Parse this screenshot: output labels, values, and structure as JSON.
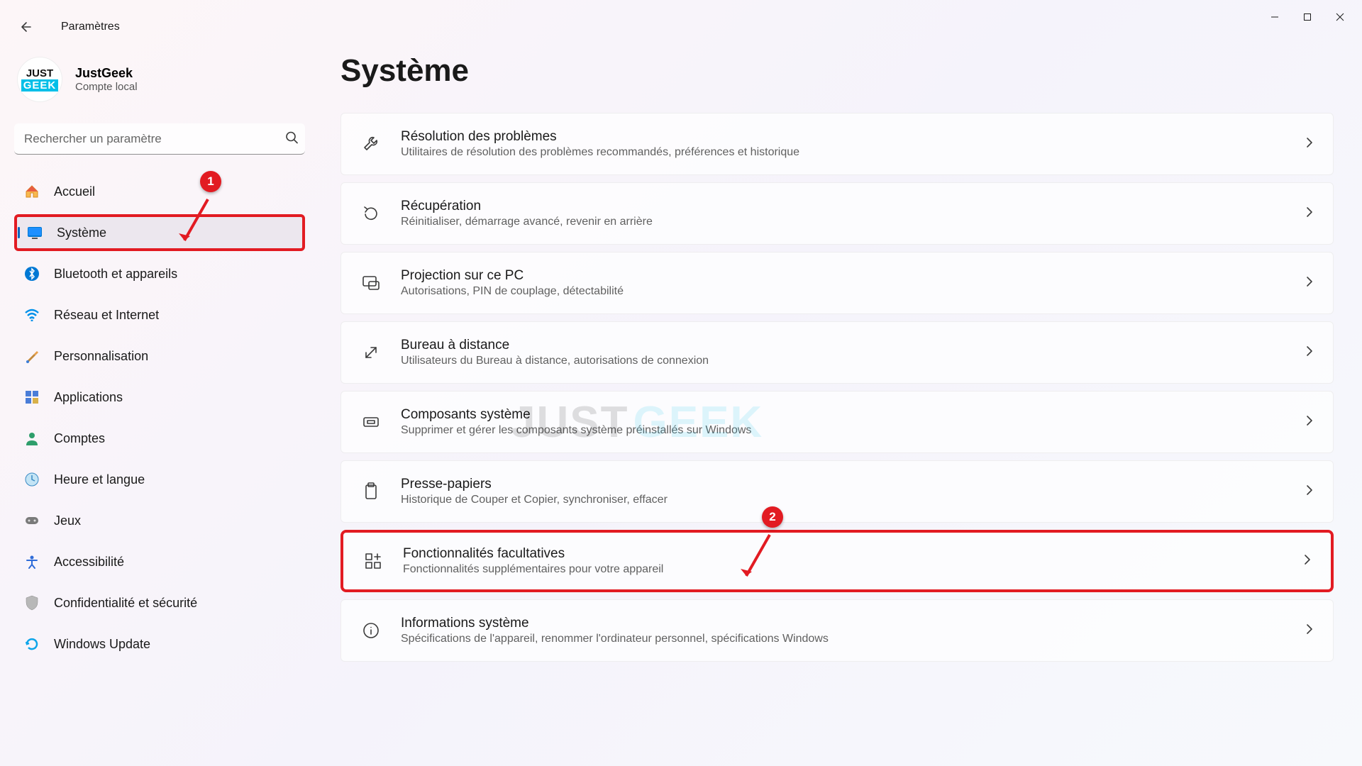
{
  "window": {
    "title": "Paramètres"
  },
  "user": {
    "name": "JustGeek",
    "account_type": "Compte local",
    "logo_top": "JUST",
    "logo_bottom": "GEEK"
  },
  "search": {
    "placeholder": "Rechercher un paramètre"
  },
  "sidebar": {
    "items": [
      {
        "id": "home",
        "label": "Accueil"
      },
      {
        "id": "system",
        "label": "Système"
      },
      {
        "id": "bluetooth",
        "label": "Bluetooth et appareils"
      },
      {
        "id": "network",
        "label": "Réseau et Internet"
      },
      {
        "id": "personalization",
        "label": "Personnalisation"
      },
      {
        "id": "apps",
        "label": "Applications"
      },
      {
        "id": "accounts",
        "label": "Comptes"
      },
      {
        "id": "time",
        "label": "Heure et langue"
      },
      {
        "id": "gaming",
        "label": "Jeux"
      },
      {
        "id": "accessibility",
        "label": "Accessibilité"
      },
      {
        "id": "privacy",
        "label": "Confidentialité et sécurité"
      },
      {
        "id": "update",
        "label": "Windows Update"
      }
    ]
  },
  "main": {
    "title": "Système",
    "cards": [
      {
        "id": "troubleshoot",
        "title": "Résolution des problèmes",
        "desc": "Utilitaires de résolution des problèmes recommandés, préférences et historique"
      },
      {
        "id": "recovery",
        "title": "Récupération",
        "desc": "Réinitialiser, démarrage avancé, revenir en arrière"
      },
      {
        "id": "projecting",
        "title": "Projection sur ce PC",
        "desc": "Autorisations, PIN de couplage, détectabilité"
      },
      {
        "id": "remote",
        "title": "Bureau à distance",
        "desc": "Utilisateurs du Bureau à distance, autorisations de connexion"
      },
      {
        "id": "components",
        "title": "Composants système",
        "desc": "Supprimer et gérer les composants système préinstallés sur Windows"
      },
      {
        "id": "clipboard",
        "title": "Presse-papiers",
        "desc": "Historique de Couper et Copier, synchroniser, effacer"
      },
      {
        "id": "optional",
        "title": "Fonctionnalités facultatives",
        "desc": "Fonctionnalités supplémentaires pour votre appareil"
      },
      {
        "id": "about",
        "title": "Informations système",
        "desc": "Spécifications de l'appareil, renommer l'ordinateur personnel, spécifications Windows"
      }
    ]
  },
  "callouts": {
    "one": "1",
    "two": "2"
  },
  "watermark": {
    "left": "JUST",
    "right": "GEEK"
  }
}
